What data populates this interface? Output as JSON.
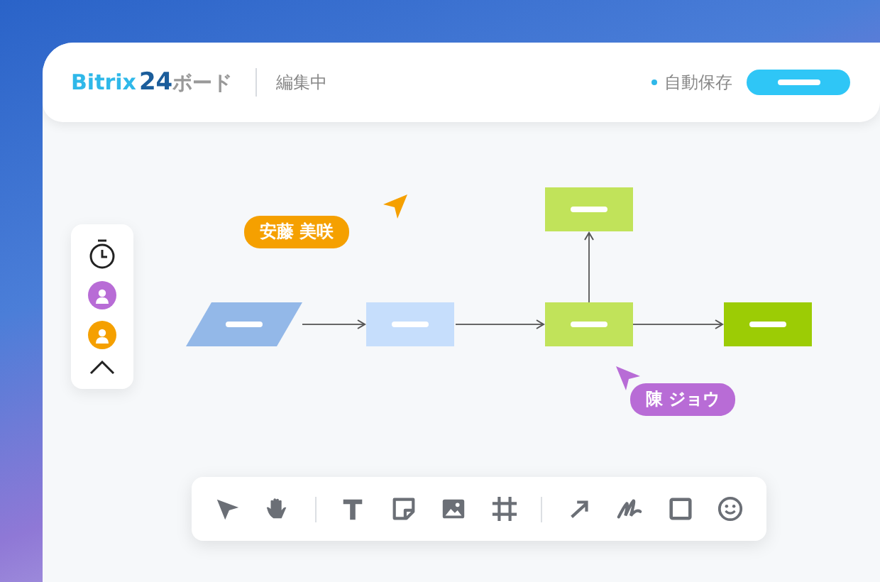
{
  "header": {
    "brand": {
      "name": "Bitrix",
      "number": "24",
      "product": "ボード"
    },
    "status": "編集中",
    "autosave": "自動保存"
  },
  "presence": [
    {
      "kind": "avatar",
      "color": "#b86cd6"
    },
    {
      "kind": "avatar",
      "color": "#f5a000"
    }
  ],
  "nodes": [
    {
      "kind": "parallelogram",
      "color": "#93b8e8"
    },
    {
      "kind": "rect",
      "color": "#c6defc"
    },
    {
      "kind": "rect",
      "color": "#c1e35a"
    },
    {
      "kind": "rect",
      "color": "#c1e35a"
    },
    {
      "kind": "rect",
      "color": "#9ccc05"
    }
  ],
  "cursors": [
    {
      "name": "安藤 美咲",
      "color": "#f5a000"
    },
    {
      "name": "陳 ジョウ",
      "color": "#b86cd6"
    }
  ]
}
